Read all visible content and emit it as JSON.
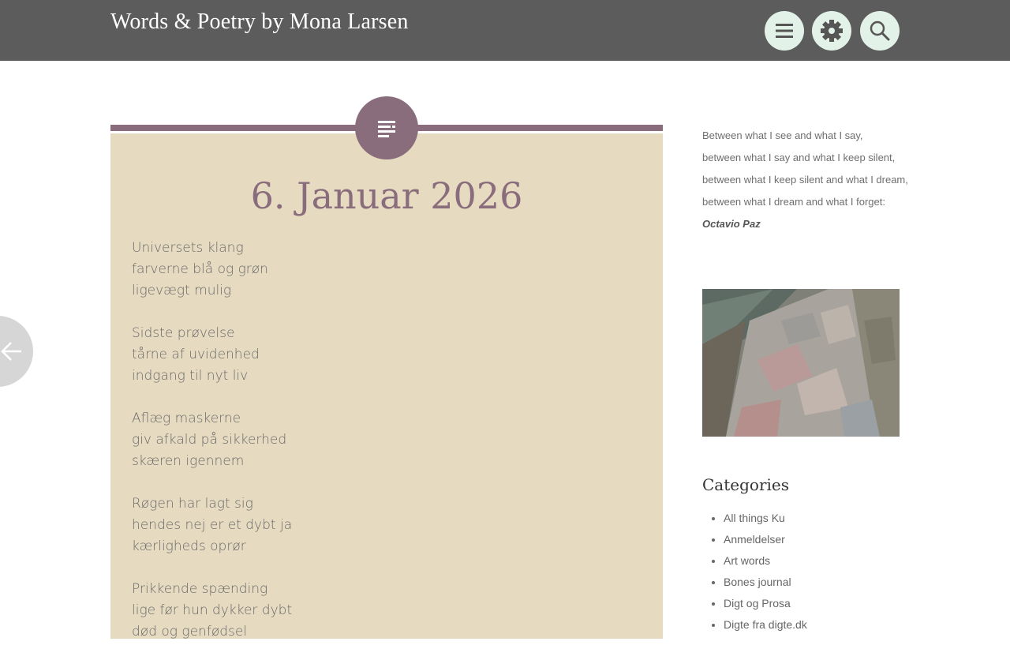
{
  "site": {
    "title": "Words & Poetry by Mona Larsen"
  },
  "header": {
    "buttons": [
      {
        "name": "menu-icon"
      },
      {
        "name": "gear-icon"
      },
      {
        "name": "search-icon"
      }
    ],
    "colors": {
      "bar": "#5c5c5c",
      "button": "#e3f2e8"
    }
  },
  "post": {
    "title": "6. Januar 2026",
    "format_icon": "text-lines-icon",
    "stanzas": [
      [
        "Universets klang",
        "farverne blå og grøn",
        "ligevægt mulig"
      ],
      [
        "Sidste prøvelse",
        "tårne af uvidenhed",
        "indgang til nyt liv"
      ],
      [
        "Aflæg maskerne",
        "giv afkald på sikkerhed",
        "skæren igennem"
      ],
      [
        "Røgen har lagt sig",
        "hendes nej er et dybt ja",
        "kærligheds oprør"
      ],
      [
        "Prikkende spænding",
        "lige før hun dykker dybt",
        "død og genfødsel"
      ]
    ],
    "colors": {
      "accent": "#8a6d7c",
      "card": "#e6dac0"
    }
  },
  "nav": {
    "prev_icon": "arrow-left-icon"
  },
  "sidebar": {
    "quote": {
      "lines": [
        "Between what I see and what I say,",
        "between what I say and what I keep silent,",
        "between what I keep silent and what I dream,",
        "between what I dream and what I forget:"
      ],
      "author": "Octavio Paz"
    },
    "categories": {
      "title": "Categories",
      "items": [
        "All things Ku",
        "Anmeldelser",
        "Art words",
        "Bones journal",
        "Digt og Prosa",
        "Digte fra digte.dk"
      ]
    }
  }
}
